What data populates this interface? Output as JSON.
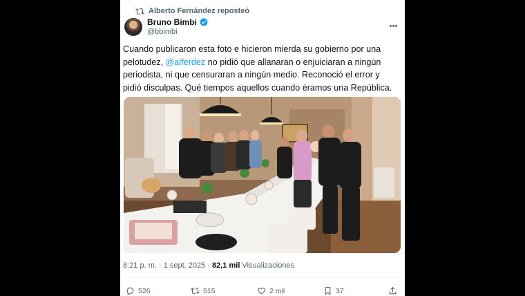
{
  "repost": {
    "label": "Alberto Fernández reposteó"
  },
  "author": {
    "name": "Bruno Bimbi",
    "handle": "@bbimbi"
  },
  "tweet": {
    "text_before": "Cuando publicaron esta foto e hicieron mierda su gobierno por una pelotudez, ",
    "mention": "@alferdez",
    "text_after": " no pidió que allanaran o enjuiciaran a ningún periodista, ni que censuraran a ningún medio. Reconoció el error y pidió disculpas. Qué tiempos aquellos cuando éramos una República."
  },
  "meta": {
    "timestamp": "8:21 p. m. · 1 sept. 2025 · ",
    "views_count": "82,1 mil",
    "views_label": " Visualizaciones"
  },
  "actions": {
    "replies": "526",
    "reposts": "515",
    "likes": "2 mil",
    "bookmarks": "37"
  },
  "colors": {
    "accent": "#1d9bf0",
    "text": "#0f1419",
    "muted": "#536471"
  }
}
